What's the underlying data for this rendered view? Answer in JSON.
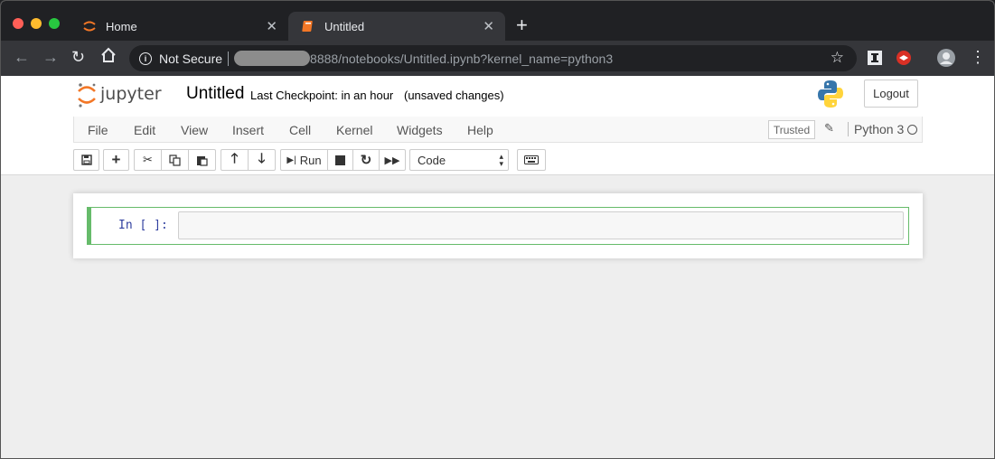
{
  "browser": {
    "tabs": [
      {
        "label": "Home",
        "active": false
      },
      {
        "label": "Untitled",
        "active": true
      }
    ],
    "security_label": "Not Secure",
    "url_visible": "8888/notebooks/Untitled.ipynb?kernel_name=python3",
    "traffic_lights": {
      "close": "#ff5f57",
      "minimize": "#febc2e",
      "zoom": "#28c840"
    }
  },
  "jupyter": {
    "logo_text": "jupyter",
    "notebook_title": "Untitled",
    "checkpoint": "Last Checkpoint: in an hour",
    "save_status": "(unsaved changes)",
    "logout_label": "Logout",
    "menus": [
      "File",
      "Edit",
      "View",
      "Insert",
      "Cell",
      "Kernel",
      "Widgets",
      "Help"
    ],
    "trusted_label": "Trusted",
    "kernel_name": "Python 3",
    "run_label": "Run",
    "cell_type": "Code",
    "cell_prompt": "In [ ]:",
    "accent": "#f37726",
    "cell_border": "#66bb6a"
  }
}
